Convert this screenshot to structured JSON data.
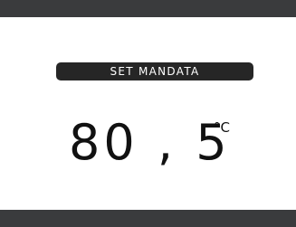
{
  "colors": {
    "bar": "#3a3b3d",
    "pill": "#262626",
    "background": "#ffffff",
    "text": "#111111"
  },
  "display": {
    "label": "SET MANDATA",
    "value": "80 , 5",
    "unit": "°C"
  }
}
